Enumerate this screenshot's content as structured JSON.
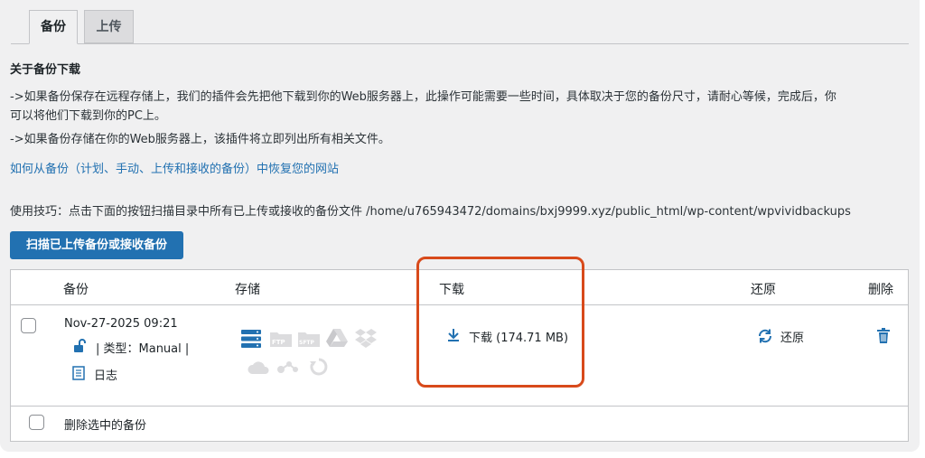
{
  "tabs": [
    {
      "label": "备份"
    },
    {
      "label": "上传"
    }
  ],
  "about": {
    "title": "关于备份下载",
    "line1": "->如果备份保存在远程存储上，我们的插件会先把他下载到你的Web服务器上，此操作可能需要一些时间，具体取决于您的备份尺寸，请耐心等候，完成后，你",
    "line1b": "可以将他们下载到你的PC上。",
    "line2": "->如果备份存储在你的Web服务器上，该插件将立即列出所有相关文件。"
  },
  "restore_link": "如何从备份（计划、手动、上传和接收的备份）中恢复您的网站",
  "tip": "使用技巧：点击下面的按钮扫描目录中所有已上传或接收的备份文件 /home/u765943472/domains/bxj9999.xyz/public_html/wp-content/wpvividbackups",
  "scan_button": "扫描已上传备份或接收备份",
  "table": {
    "headers": {
      "backup": "备份",
      "storage": "存储",
      "download": "下载",
      "restore": "还原",
      "delete": "删除"
    },
    "row": {
      "date": "Nov-27-2025 09:21",
      "type": "| 类型：Manual |",
      "log": "日志",
      "download_label": "下载 (174.71 MB)",
      "restore_label": "还原"
    },
    "footer_action": "删除选中的备份"
  },
  "colors": {
    "primary": "#2271b1",
    "highlight": "#d84a1b",
    "background": "#f0f0f1"
  },
  "icons": [
    "unlock-icon",
    "log-file-icon",
    "server-storage-icon",
    "ftp-icon",
    "sftp-icon",
    "google-drive-icon",
    "dropbox-icon",
    "onedrive-icon",
    "s3-icon",
    "b2-icon",
    "download-icon",
    "restore-icon",
    "trash-icon"
  ]
}
